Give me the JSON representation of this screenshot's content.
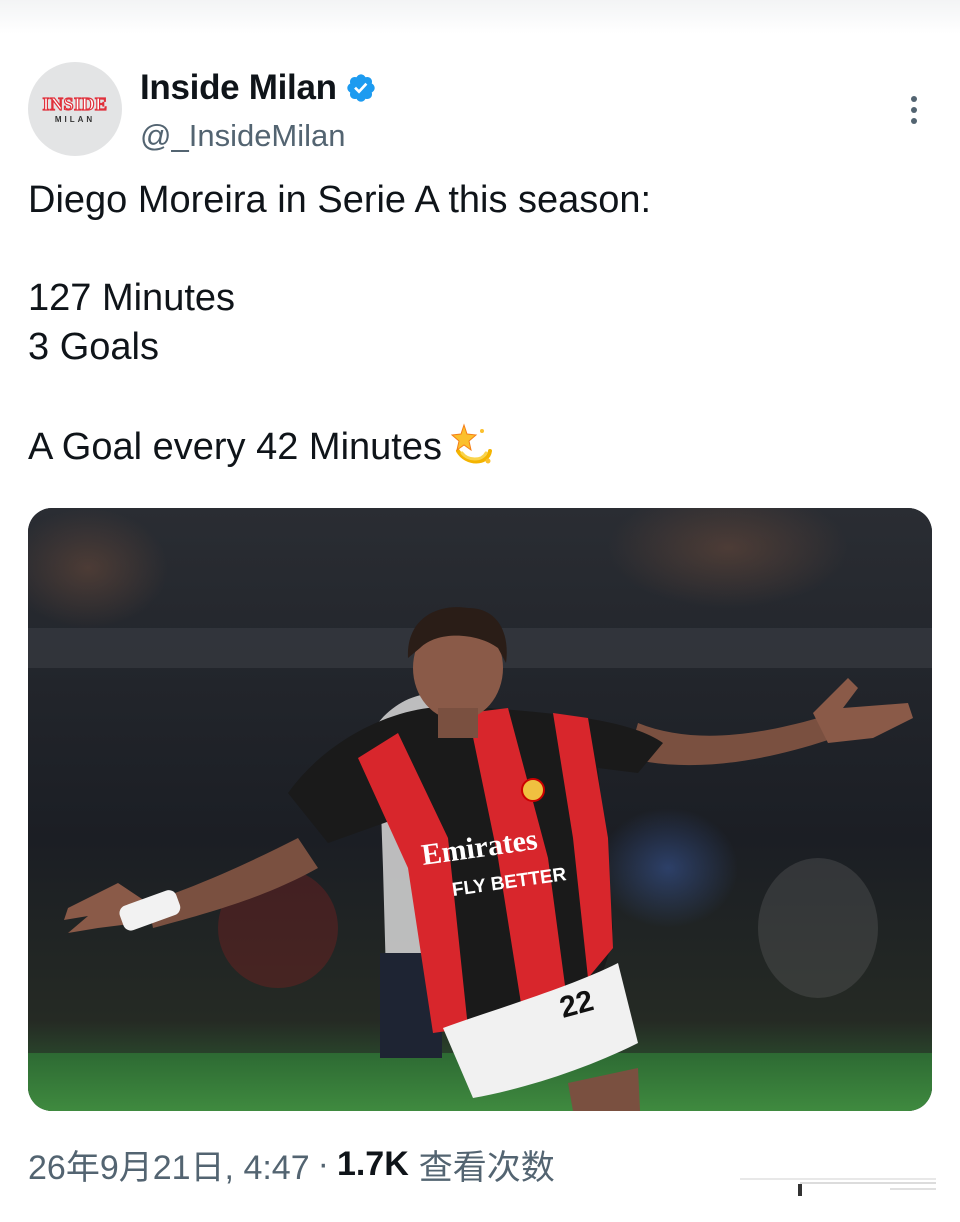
{
  "author": {
    "display_name": "Inside Milan",
    "handle": "@_InsideMilan",
    "avatar_logo_main": "INSIDE",
    "avatar_logo_sub": "MILAN",
    "verified": true,
    "verified_color": "#1d9bf0"
  },
  "tweet": {
    "lines": [
      "Diego Moreira in Serie A this season:",
      "",
      "127 Minutes",
      "3 Goals",
      "",
      "A Goal every 42 Minutes"
    ],
    "trailing_emoji": "dizzy-sparkle-icon"
  },
  "media": {
    "jersey_sponsor": "Emirates",
    "jersey_slogan": "FLY BETTER",
    "shorts_number": "22"
  },
  "meta": {
    "timestamp": "26年9月21日, 4:47",
    "separator": "·",
    "views_count": "1.7K",
    "views_label": "查看次数"
  },
  "colors": {
    "text_primary": "#0f1419",
    "text_secondary": "#536471",
    "accent_red": "#e0303b"
  }
}
